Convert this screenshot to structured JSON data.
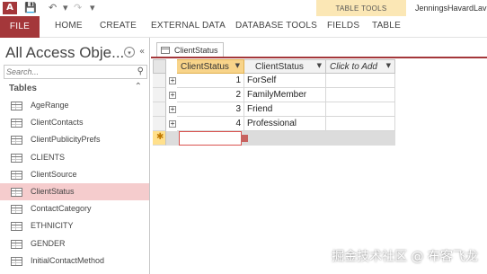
{
  "app": {
    "icon_label": "A",
    "quick_access": [
      "save-icon",
      "undo-icon",
      "redo-icon"
    ],
    "window_title": "JenningsHavardLav",
    "table_tools_label": "TABLE TOOLS"
  },
  "ribbon": {
    "file": "FILE",
    "tabs": [
      "HOME",
      "CREATE",
      "EXTERNAL DATA",
      "DATABASE TOOLS",
      "FIELDS",
      "TABLE"
    ]
  },
  "nav": {
    "title": "All Access Obje...",
    "search_placeholder": "Search...",
    "group_label": "Tables",
    "items": [
      "AgeRange",
      "ClientContacts",
      "ClientPublicityPrefs",
      "CLIENTS",
      "ClientSource",
      "ClientStatus",
      "ContactCategory",
      "ETHNICITY",
      "GENDER",
      "InitialContactMethod"
    ],
    "selected_item": "ClientStatus"
  },
  "document": {
    "tab_label": "ClientStatus",
    "columns": [
      "ClientStatus",
      "ClientStatus",
      "Click to Add"
    ],
    "rows": [
      {
        "id": "1",
        "status": "ForSelf"
      },
      {
        "id": "2",
        "status": "FamilyMember"
      },
      {
        "id": "3",
        "status": "Friend"
      },
      {
        "id": "4",
        "status": "Professional"
      }
    ]
  },
  "watermark": "掘金技术社区 @ 布客飞龙",
  "colors": {
    "accent": "#a4373a",
    "table_tools": "#fbe7b5",
    "selected_row": "#f5cccd",
    "selected_header": "#f8d48a"
  }
}
